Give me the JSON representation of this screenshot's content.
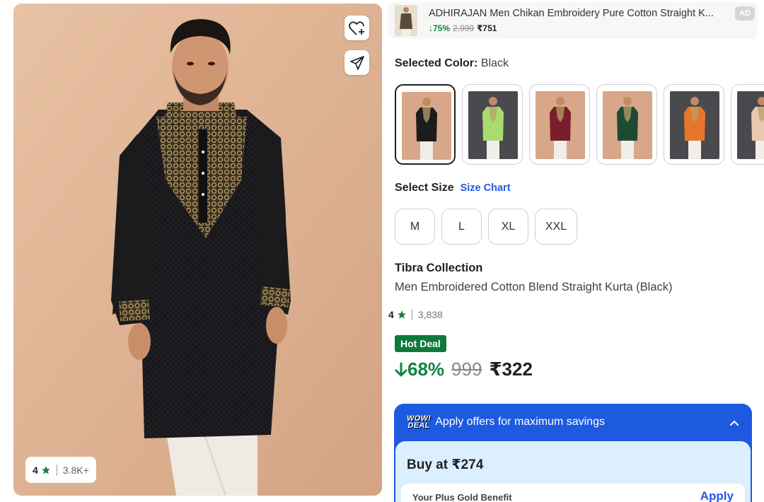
{
  "hero": {
    "rating": "4",
    "rating_count": "3.8K+"
  },
  "ad": {
    "title": "ADHIRAJAN Men Chikan Embroidery Pure Cotton Straight K...",
    "discount": "75%",
    "mrp": "2,999",
    "price": "₹751",
    "badge": "AD"
  },
  "color": {
    "label": "Selected Color:",
    "value": "Black",
    "swatches": [
      {
        "name": "Black",
        "kurta": "#1c1c1e",
        "bg": "#d8a789",
        "selected": true
      },
      {
        "name": "Lime Green",
        "kurta": "#a9dc6e",
        "bg": "#4a4a4e",
        "selected": false
      },
      {
        "name": "Maroon",
        "kurta": "#7a1e2e",
        "bg": "#d8a789",
        "selected": false
      },
      {
        "name": "Dark Green",
        "kurta": "#1e4a34",
        "bg": "#d8a789",
        "selected": false
      },
      {
        "name": "Orange",
        "kurta": "#e8762a",
        "bg": "#4a4a4e",
        "selected": false
      },
      {
        "name": "Peach",
        "kurta": "#e9c7b0",
        "bg": "#4a4a4e",
        "selected": false
      }
    ]
  },
  "size": {
    "label": "Select Size",
    "chart_link": "Size Chart",
    "options": [
      "M",
      "L",
      "XL",
      "XXL"
    ]
  },
  "product": {
    "brand": "Tibra Collection",
    "name": "Men Embroidered Cotton Blend Straight Kurta (Black)",
    "rating": "4",
    "rating_count": "3,838",
    "deal_badge": "Hot Deal",
    "discount": "68%",
    "mrp": "999",
    "price": "₹322"
  },
  "offers": {
    "logo_line1": "WOW!",
    "logo_line2": "DEAL",
    "title": "Apply offers for maximum savings",
    "buy_at": "Buy at ₹274",
    "benefit_label": "Your Plus Gold Benefit",
    "apply_label": "Apply"
  },
  "colors": {
    "green": "#14823e",
    "hot_deal": "#0e7a3a",
    "link_blue": "#2a55e5",
    "offers_blue": "#1e5ae0",
    "offers_inner": "#dcefff"
  }
}
